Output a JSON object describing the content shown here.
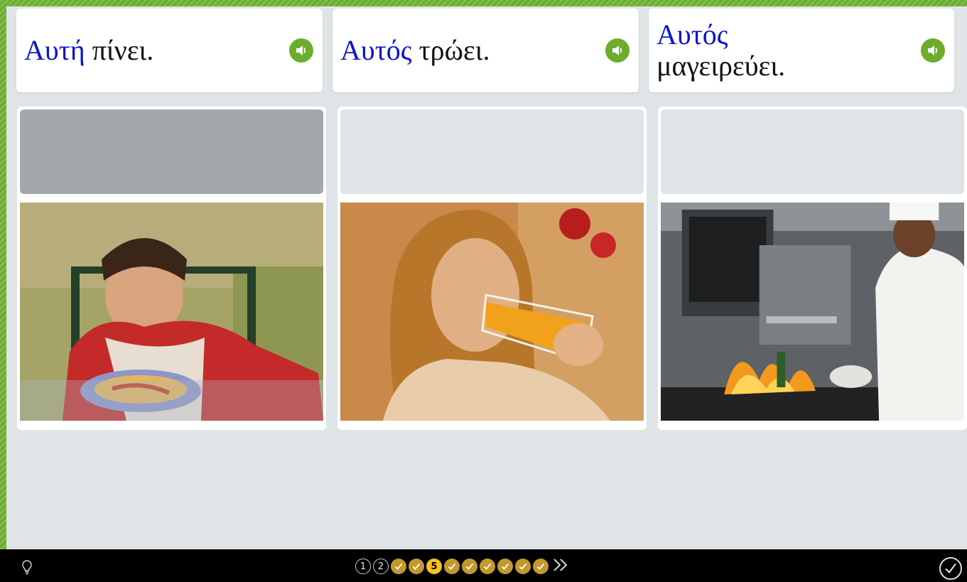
{
  "prompts": [
    {
      "highlight": "Αυτή",
      "rest": " πίνει."
    },
    {
      "highlight": "Αυτός",
      "rest": " τρώει."
    },
    {
      "highlight": "Αυτός",
      "rest": " μαγειρεύει."
    }
  ],
  "icons": {
    "speaker": "speaker-icon",
    "hint": "lightbulb-icon",
    "next": "double-chevron-right-icon",
    "check": "checkmark-icon"
  },
  "photos": [
    {
      "name": "boy-eating-spaghetti-photo"
    },
    {
      "name": "woman-drinking-juice-photo"
    },
    {
      "name": "chef-cooking-photo"
    }
  ],
  "progress": {
    "steps": [
      {
        "label": "1",
        "state": "number"
      },
      {
        "label": "2",
        "state": "number"
      },
      {
        "label": "",
        "state": "done"
      },
      {
        "label": "",
        "state": "done"
      },
      {
        "label": "5",
        "state": "current"
      },
      {
        "label": "",
        "state": "done"
      },
      {
        "label": "",
        "state": "done"
      },
      {
        "label": "",
        "state": "done"
      },
      {
        "label": "",
        "state": "done"
      },
      {
        "label": "",
        "state": "done"
      },
      {
        "label": "",
        "state": "done"
      }
    ]
  },
  "colors": {
    "highlight": "#0b16c9",
    "speaker": "#6cad2c",
    "step_done": "#c29a2c",
    "step_current": "#f6c21c"
  }
}
